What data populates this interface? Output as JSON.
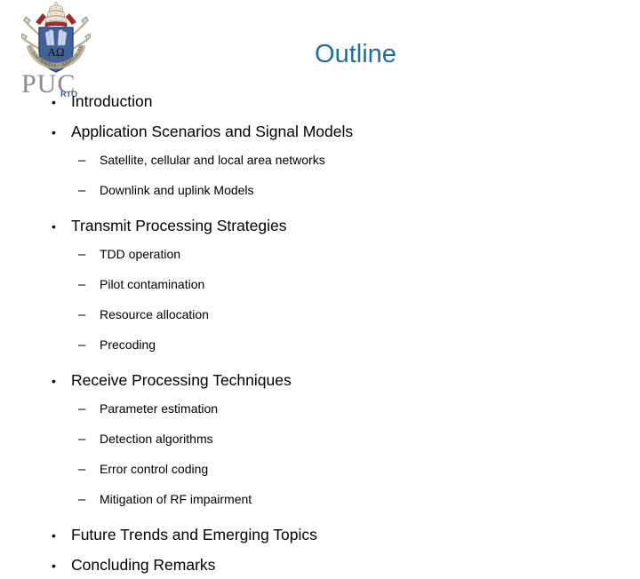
{
  "slide": {
    "title": "Outline",
    "title_color": "#1F6FA0",
    "background_color": "#FFFFFF"
  },
  "logo": {
    "name": "puc-rio-logo",
    "wordmark": "PUC",
    "wordmark_color": "#8C8C8C",
    "sub_wordmark": "RIO",
    "sub_wordmark_color": "#2B5FA0",
    "crest": {
      "name": "puc-rio-crest",
      "shield_letters": "ΑΩ",
      "shield_color": "#41619B",
      "crown_color": "#EFE7D6",
      "crown_band_color": "#9E2B2B"
    }
  },
  "outline": {
    "items": [
      {
        "level": 1,
        "marker": "•",
        "text": "Introduction"
      },
      {
        "level": 1,
        "marker": "•",
        "text": "Application Scenarios and Signal Models"
      },
      {
        "level": 2,
        "marker": "–",
        "text": "Satellite, cellular and local area networks"
      },
      {
        "level": 2,
        "marker": "–",
        "text": "Downlink and uplink Models"
      },
      {
        "level": 1,
        "marker": "•",
        "text": "Transmit Processing Strategies"
      },
      {
        "level": 2,
        "marker": "–",
        "text": "TDD operation"
      },
      {
        "level": 2,
        "marker": "–",
        "text": "Pilot contamination"
      },
      {
        "level": 2,
        "marker": "–",
        "text": "Resource allocation"
      },
      {
        "level": 2,
        "marker": "–",
        "text": "Precoding"
      },
      {
        "level": 1,
        "marker": "•",
        "text": "Receive Processing Techniques"
      },
      {
        "level": 2,
        "marker": "–",
        "text": "Parameter estimation"
      },
      {
        "level": 2,
        "marker": "–",
        "text": "Detection algorithms"
      },
      {
        "level": 2,
        "marker": "–",
        "text": "Error control coding"
      },
      {
        "level": 2,
        "marker": "–",
        "text": "Mitigation of RF impairment"
      },
      {
        "level": 1,
        "marker": "•",
        "text": "Future Trends and Emerging Topics"
      },
      {
        "level": 1,
        "marker": "•",
        "text": "Concluding Remarks"
      }
    ]
  }
}
